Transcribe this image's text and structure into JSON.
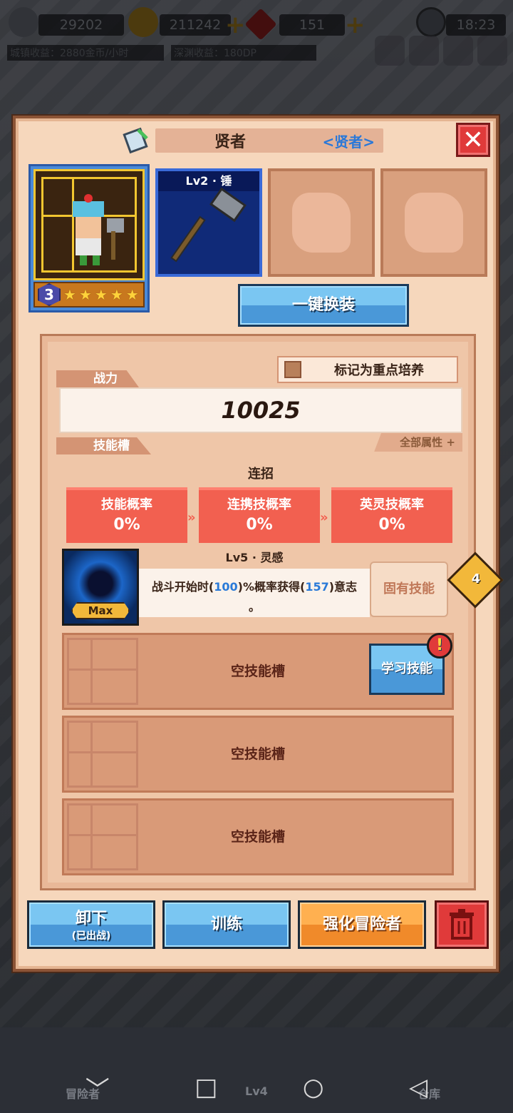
{
  "topbar": {
    "resource1": "29202",
    "resource2": "211242",
    "resource3": "151",
    "time": "18:23",
    "town_income": "城镇收益：2880金币/小时",
    "abyss_income": "深渊收益：180DP"
  },
  "dialog": {
    "title": "贤者",
    "class_tag": "<贤者>",
    "close_label": "✕",
    "hero": {
      "level": "3",
      "stars": 5
    },
    "weapon_label": "Lv2 · 锤",
    "equip_all_label": "一键换装",
    "power": {
      "tab_label": "战力",
      "value": "10025",
      "mark_label": "标记为重点培养",
      "all_attr_label": "全部属性"
    },
    "skills": {
      "tab_label": "技能槽",
      "combo_title": "连招",
      "combo": [
        {
          "label": "技能概率",
          "value": "0%"
        },
        {
          "label": "连携技概率",
          "value": "0%"
        },
        {
          "label": "英灵技概率",
          "value": "0%"
        }
      ],
      "skill1": {
        "name": "Lv5 · 灵感",
        "max_tag": "Max",
        "desc_prefix": "战斗开始时(",
        "num1": "100",
        "desc_mid": ")%概率获得(",
        "num2": "157",
        "desc_suffix": ")意志",
        "desc_end": "。",
        "innate_label": "固有技能",
        "gem_count": "4"
      },
      "empty_label": "空技能槽",
      "learn_label": "学习技能",
      "alert": "!"
    },
    "buttons": {
      "unequip_label": "卸下",
      "unequip_sub": "(已出战)",
      "train_label": "训练",
      "enhance_label": "强化冒险者"
    }
  },
  "game_nav": {
    "left_label": "冒险者",
    "center_label": "Lv4",
    "right_label": "仓库"
  },
  "sys_nav": {
    "back": "◁",
    "home": "○",
    "recent": "□",
    "down": "﹀"
  }
}
